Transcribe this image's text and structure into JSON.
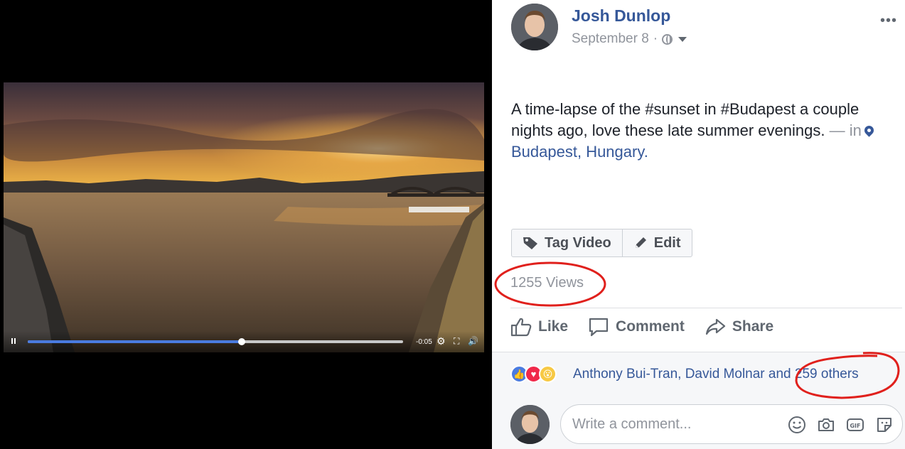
{
  "video": {
    "time_remaining": "-0:05",
    "progress_fraction": 0.57,
    "icons": {
      "pause": "pause-icon",
      "settings": "gear-icon",
      "fullscreen": "fullscreen-icon",
      "volume": "volume-icon"
    }
  },
  "post": {
    "author": "Josh Dunlop",
    "date": "September 8",
    "separator": "·",
    "text_part1": "A time-lapse of the #sunset in #Budapest a couple nights ago, love these late summer evenings.",
    "text_dash": " — in",
    "location": "Budapest, Hungary",
    "location_suffix": ".",
    "buttons": {
      "tag_video": "Tag Video",
      "edit": "Edit"
    },
    "views": "1255 Views",
    "actions": {
      "like": "Like",
      "comment": "Comment",
      "share": "Share"
    },
    "reactions": {
      "names": "Anthony Bui-Tran, David Molnar and 259 others"
    },
    "comment_box": {
      "placeholder": "Write a comment..."
    }
  },
  "colors": {
    "link_blue": "#365899",
    "annotation_red": "#e0201c",
    "progress_blue": "#4a7be0"
  }
}
